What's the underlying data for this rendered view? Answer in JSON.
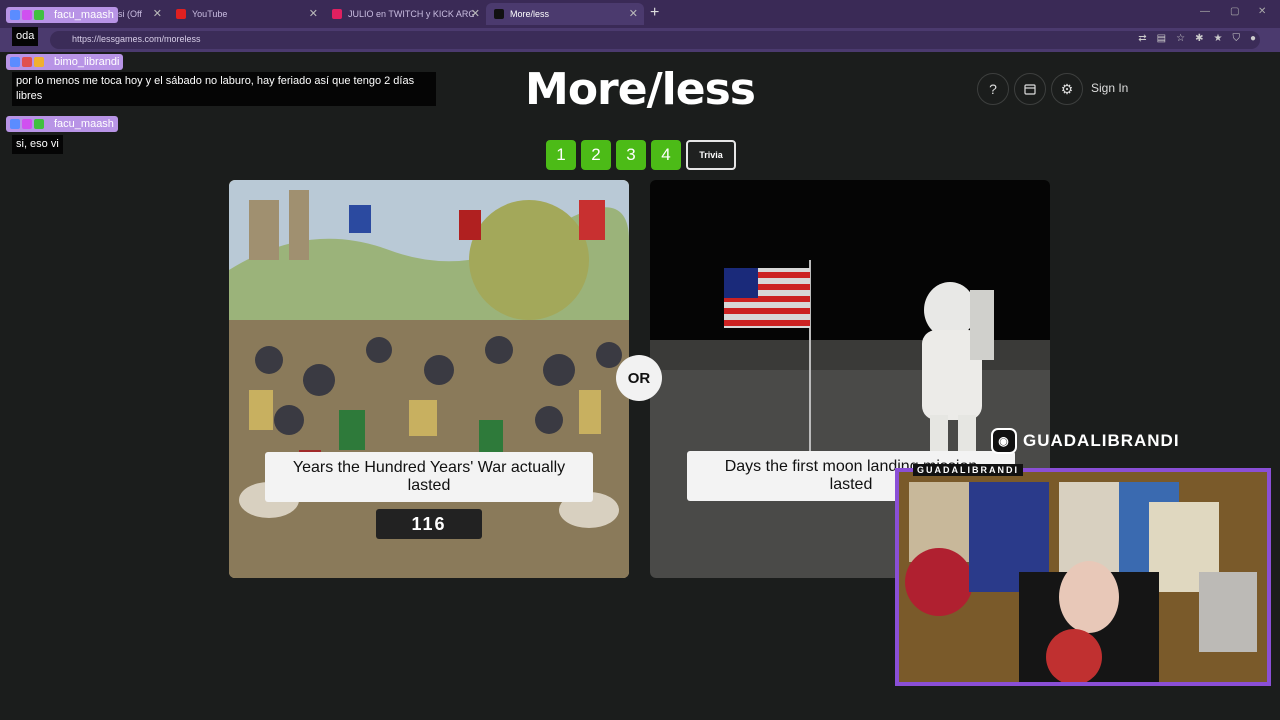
{
  "browser": {
    "tabs": [
      {
        "label": "si (Off"
      },
      {
        "label": "YouTube"
      },
      {
        "label": "JULIO en TWITCH y KICK ARGENTI"
      },
      {
        "label": "More/less"
      }
    ],
    "url": "https://lessgames.com/moreless"
  },
  "page": {
    "logo": "More/less",
    "help_icon": "?",
    "sign_in": "Sign In",
    "levels": [
      "1",
      "2",
      "3",
      "4"
    ],
    "trivia_label": "Trivia",
    "or_label": "OR",
    "left_card": {
      "caption": "Years the Hundred Years' War actually lasted",
      "value": "116"
    },
    "right_card": {
      "caption": "Days the first moon landing mission lasted"
    }
  },
  "chat": [
    {
      "user": "facu_maash",
      "text": "oda"
    },
    {
      "user": "bimo_librandi",
      "text": "por lo menos me toca hoy y el sábado no laburo, hay feriado así que tengo 2 días libres"
    },
    {
      "user": "facu_maash",
      "text": "si, eso vi"
    }
  ],
  "stream": {
    "instagram": "GUADALIBRANDI",
    "cam_label": "GUADALIBRANDI"
  },
  "colors": {
    "level_green": "#4cbb17",
    "browser_purple": "#4b3a6e",
    "cam_border": "#8a4fd6",
    "chat_name_bg": "#b894e6"
  }
}
